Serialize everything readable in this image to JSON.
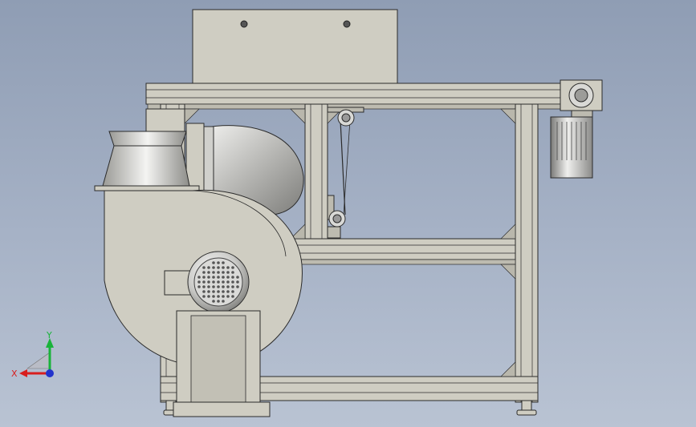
{
  "viewport": {
    "background_top": "#8f9db4",
    "background_bottom": "#b9c3d3"
  },
  "model": {
    "parts": [
      "control-box",
      "aluminum-frame",
      "centrifugal-fan",
      "elbow-duct",
      "inlet-hood",
      "fan-motor",
      "gear-motor",
      "belt-tensioner"
    ],
    "colors": {
      "part_fill": "#cfcdc2",
      "part_shadow": "#a9a79c",
      "edge": "#2b2b2b",
      "steel": "#c8c8c8"
    }
  },
  "triad": {
    "x_label": "X",
    "y_label": "Y",
    "x_color": "#d81e1e",
    "y_color": "#19b33a",
    "z_color": "#2233cc"
  }
}
